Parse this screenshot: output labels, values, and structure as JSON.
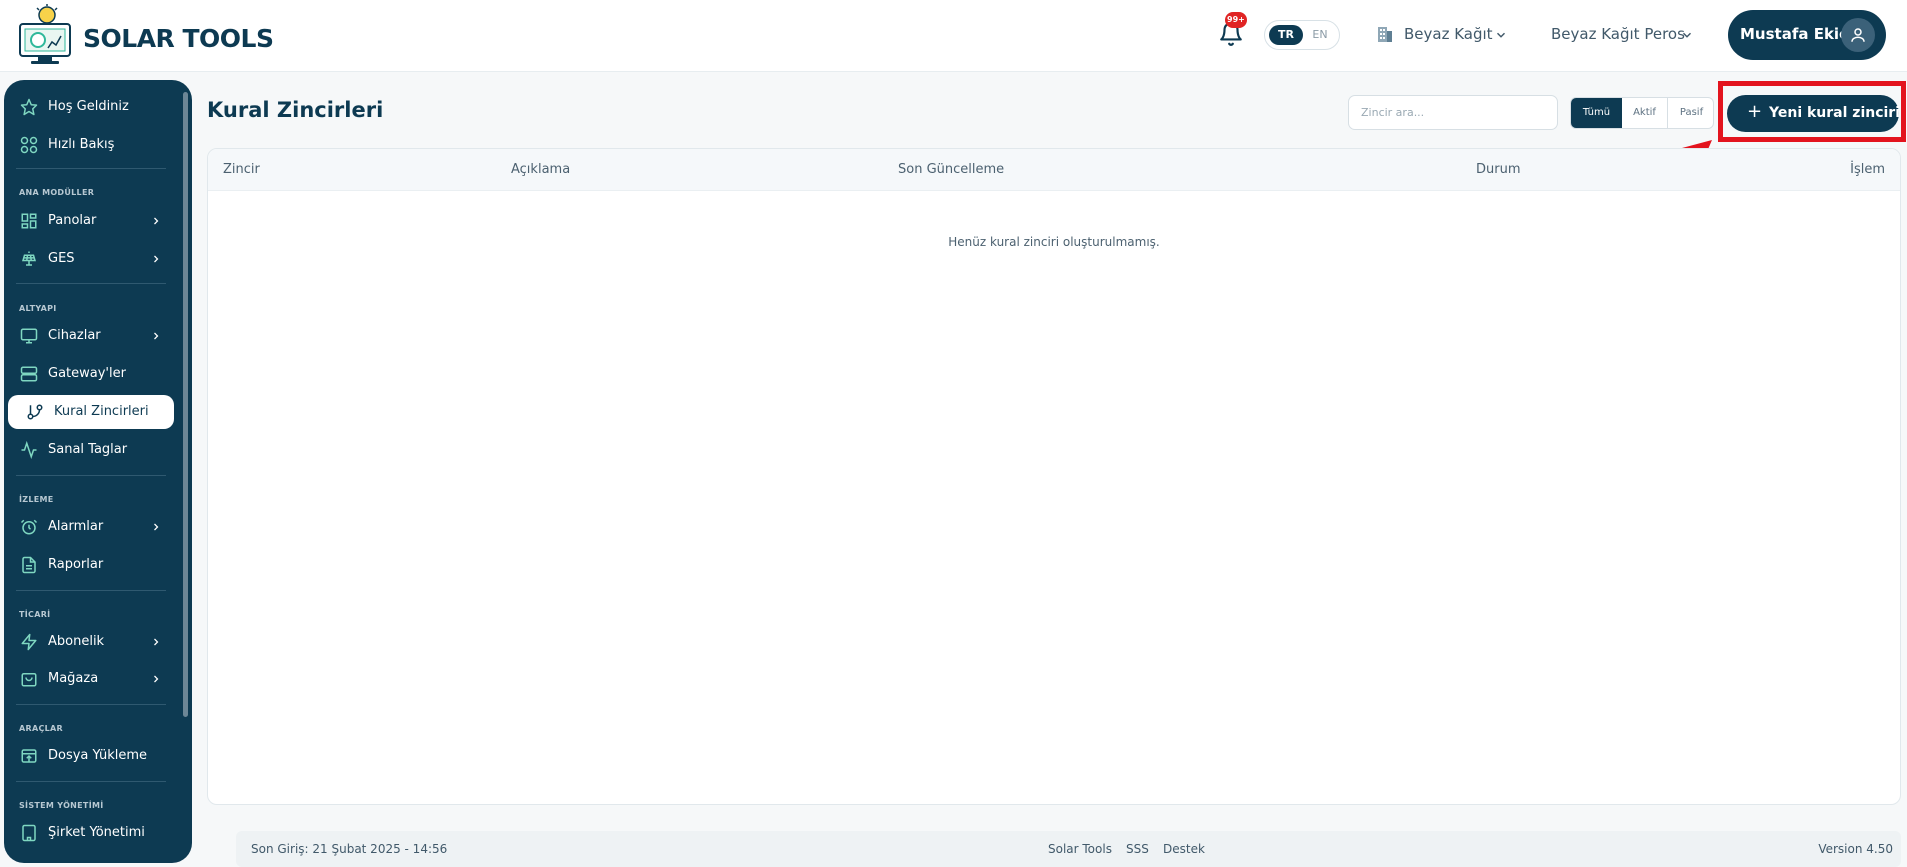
{
  "app": {
    "brand": "SOLAR TOOLS",
    "notifications_badge": "99+",
    "languages": [
      "TR",
      "EN"
    ],
    "active_language": "TR",
    "company": "Beyaz Kağıt",
    "plant": "Beyaz Kağıt Peros",
    "user": "Mustafa Ekici"
  },
  "sidebar": {
    "items": [
      {
        "label": "Hoş Geldiniz",
        "icon": "star-icon"
      },
      {
        "label": "Hızlı Bakış",
        "icon": "grid-icon"
      },
      {
        "label": "Panolar",
        "icon": "dashboard-icon"
      },
      {
        "label": "GES",
        "icon": "solar-panel-icon"
      },
      {
        "label": "Cihazlar",
        "icon": "monitor-icon"
      },
      {
        "label": "Gateway'ler",
        "icon": "server-icon"
      },
      {
        "label": "Kural Zincirleri",
        "icon": "git-branch-icon"
      },
      {
        "label": "Sanal Taglar",
        "icon": "activity-icon"
      },
      {
        "label": "Alarmlar",
        "icon": "alarm-clock-icon"
      },
      {
        "label": "Raporlar",
        "icon": "file-text-icon"
      },
      {
        "label": "Abonelik",
        "icon": "zap-icon"
      },
      {
        "label": "Mağaza",
        "icon": "shopping-bag-icon"
      },
      {
        "label": "Dosya Yükleme",
        "icon": "upload-icon"
      },
      {
        "label": "Şirket Yönetimi",
        "icon": "building-icon"
      }
    ],
    "sections": [
      "ANA MODÜLLER",
      "ALTYAPI",
      "İZLEME",
      "TİCARİ",
      "ARAÇLAR",
      "SİSTEM YÖNETİMİ"
    ],
    "active_item": "Kural Zincirleri"
  },
  "main": {
    "title": "Kural Zincirleri",
    "search_placeholder": "Zincir ara...",
    "filters": [
      "Tümü",
      "Aktif",
      "Pasif"
    ],
    "active_filter": "Tümü",
    "new_button_label": "Yeni kural zinciri",
    "table": {
      "columns": [
        "Zincir",
        "Açıklama",
        "Son Güncelleme",
        "Durum",
        "İşlem"
      ],
      "empty_message": "Henüz kural zinciri oluşturulmamış."
    }
  },
  "footer": {
    "last_login": "Son Giriş: 21 Şubat 2025 - 14:56",
    "links": [
      "Solar Tools",
      "SSS",
      "Destek"
    ],
    "version": "Version 4.50"
  },
  "colors": {
    "primary": "#0d3a52",
    "accent": "#2fb89a",
    "highlight": "#e3141e",
    "badge": "#e02424"
  }
}
